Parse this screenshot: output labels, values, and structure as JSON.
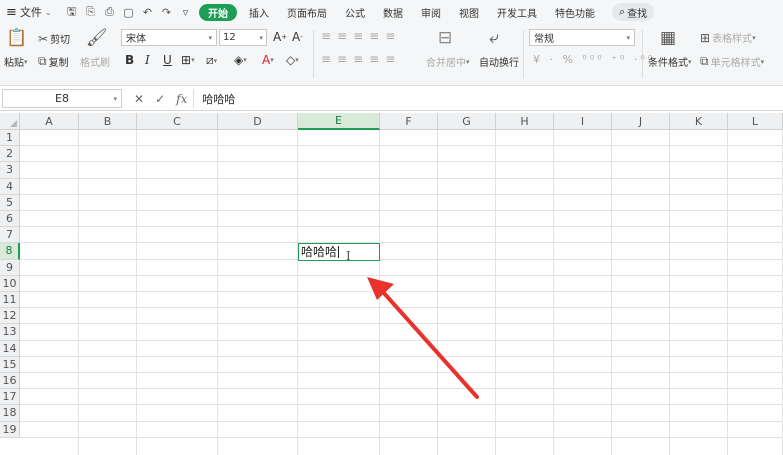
{
  "menubar": {
    "file_label": "文件",
    "quick_access_icons": [
      "save-icon",
      "clipboard-icon",
      "print-icon",
      "print-preview-icon",
      "undo-icon",
      "redo-icon",
      "customize-icon"
    ],
    "tabs": [
      {
        "label": "开始",
        "active": true
      },
      {
        "label": "插入",
        "active": false
      },
      {
        "label": "页面布局",
        "active": false
      },
      {
        "label": "公式",
        "active": false
      },
      {
        "label": "数据",
        "active": false
      },
      {
        "label": "审阅",
        "active": false
      },
      {
        "label": "视图",
        "active": false
      },
      {
        "label": "开发工具",
        "active": false
      },
      {
        "label": "特色功能",
        "active": false
      }
    ],
    "search_label": "查找"
  },
  "ribbon": {
    "paste_label": "粘贴",
    "cut_label": "剪切",
    "copy_label": "复制",
    "format_painter_label": "格式刷",
    "font_name": "宋体",
    "font_size": "12",
    "merge_center_label": "合并居中",
    "wrap_text_label": "自动换行",
    "number_format": "常规",
    "conditional_format_label": "条件格式",
    "table_style_label": "表格样式",
    "cell_style_label": "单元格样式"
  },
  "formula_bar": {
    "cell_reference": "E8",
    "formula_value": "哈哈哈"
  },
  "sheet": {
    "columns": [
      "A",
      "B",
      "C",
      "D",
      "E",
      "F",
      "G",
      "H",
      "I",
      "J",
      "K",
      "L"
    ],
    "rows": [
      "1",
      "2",
      "3",
      "4",
      "5",
      "6",
      "7",
      "8",
      "9",
      "10",
      "11",
      "12",
      "13",
      "14",
      "15",
      "16",
      "17",
      "18",
      "19"
    ],
    "selected_column": "E",
    "selected_row": "8",
    "active_cell_text": "哈哈哈"
  },
  "colors": {
    "accent": "#1d9e57",
    "annotation_arrow": "#e8322b"
  }
}
